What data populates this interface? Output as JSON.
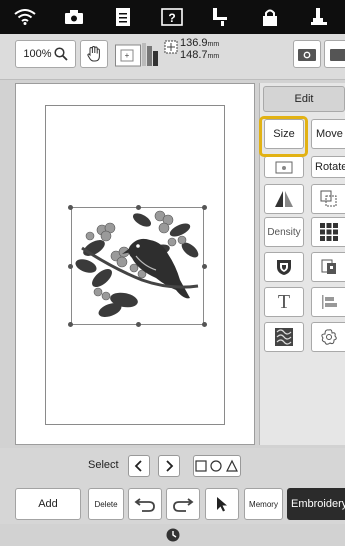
{
  "toolbar": {
    "zoom_value": "100%",
    "width_value": "136.9",
    "height_value": "148.7",
    "unit": "mm"
  },
  "panel": {
    "tab_label": "Edit",
    "size_label": "Size",
    "move_label": "Move",
    "rotate_label": "Rotate",
    "density_label": "Density",
    "text_glyph": "T"
  },
  "select_bar": {
    "label": "Select"
  },
  "action_bar": {
    "add_label": "Add",
    "delete_label": "Delete",
    "memory_label": "Memory",
    "embroidery_label": "Embroidery"
  },
  "icons": {
    "top": [
      "wifi-icon",
      "camera-icon",
      "document-icon",
      "help-icon",
      "stitch-icon",
      "lock-icon",
      "presser-foot-icon"
    ]
  },
  "colors": {
    "highlight": "#e2b214",
    "embroidery_button": "#2b2b2b"
  }
}
